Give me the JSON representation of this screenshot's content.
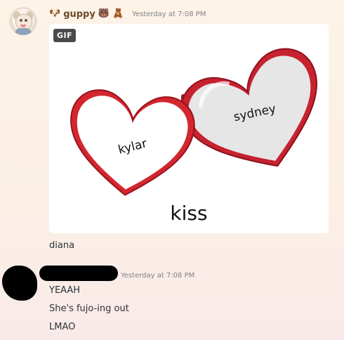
{
  "message1": {
    "username": "guppy",
    "emoji_prefix": "🐶",
    "emoji_suffix_1": "🐻",
    "emoji_suffix_2": "🧸",
    "timestamp": "Yesterday at 7:08 PM",
    "gif": {
      "badge": "GIF",
      "left_heart_label": "kylar",
      "right_heart_label": "sydney",
      "caption": "kiss"
    },
    "text": "diana"
  },
  "message2": {
    "timestamp": "Yesterday at 7:08 PM",
    "lines": [
      "YEAAH",
      "She's fujo-ing out",
      "LMAO"
    ]
  }
}
